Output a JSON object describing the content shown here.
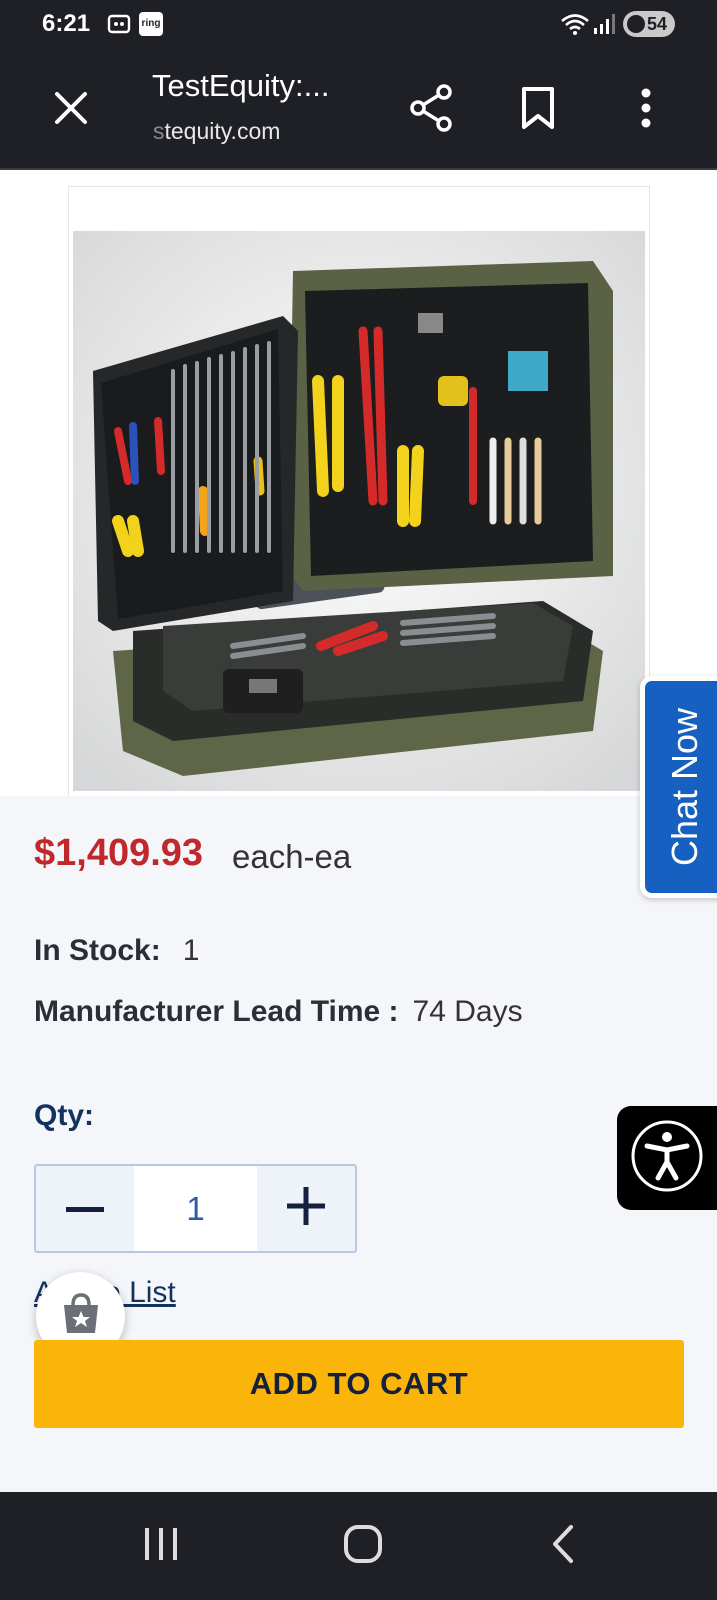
{
  "status_bar": {
    "time": "6:21",
    "ring_label": "ring",
    "battery": "54",
    "icons": [
      "screen-record-icon",
      "ring-app-icon",
      "wifi-icon",
      "signal-icon",
      "battery-icon"
    ]
  },
  "browser": {
    "title": "TestEquity:...",
    "url_faded": "s",
    "url_rest": "tequity.com",
    "icons": [
      "close-icon",
      "share-icon",
      "bookmark-icon",
      "more-vert-icon"
    ]
  },
  "product": {
    "price": "$1,409.93",
    "unit": "each-ea",
    "stock_label": "In Stock:",
    "stock_value": "1",
    "lead_label": "Manufacturer Lead Time :",
    "lead_value": "74 Days",
    "qty_label": "Qty:",
    "qty_value": "1",
    "add_to_list": "Add to List",
    "add_to_cart": "ADD TO CART"
  },
  "chat": {
    "label": "Chat Now"
  },
  "colors": {
    "price": "#c0282d",
    "cart_button": "#fbb40a",
    "chat_tab": "#1660c2",
    "link": "#12325f"
  },
  "nav": {
    "icons": [
      "recent-apps-icon",
      "home-icon",
      "back-icon"
    ]
  }
}
